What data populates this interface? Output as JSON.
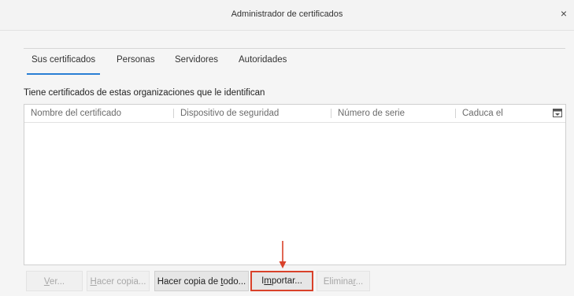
{
  "window": {
    "title": "Administrador de certificados",
    "close_glyph": "×"
  },
  "tabs": [
    {
      "label": "Sus certificados",
      "selected": true
    },
    {
      "label": "Personas",
      "selected": false
    },
    {
      "label": "Servidores",
      "selected": false
    },
    {
      "label": "Autoridades",
      "selected": false
    }
  ],
  "subheading": "Tiene certificados de estas organizaciones que le identifican",
  "table": {
    "columns": [
      "Nombre del certificado",
      "Dispositivo de seguridad",
      "Número de serie",
      "Caduca el"
    ],
    "column_picker_icon": "column-picker-icon",
    "rows": []
  },
  "buttons": {
    "view": {
      "pre": "",
      "key": "V",
      "post": "er...",
      "enabled": false
    },
    "backup": {
      "pre": "",
      "key": "H",
      "post": "acer copia...",
      "enabled": false
    },
    "backup_all": {
      "pre": "Hacer copia de ",
      "key": "t",
      "post": "odo...",
      "enabled": true
    },
    "import": {
      "pre": "I",
      "key": "m",
      "post": "portar...",
      "enabled": true
    },
    "delete": {
      "pre": "Elimina",
      "key": "r",
      "post": "...",
      "enabled": false
    }
  },
  "annotation": {
    "color": "#d9412a",
    "icon": "down-arrow-icon"
  }
}
